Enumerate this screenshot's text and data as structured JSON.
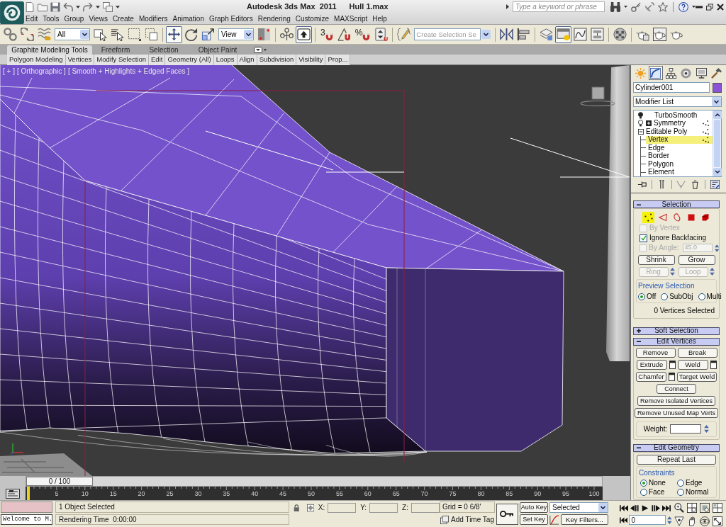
{
  "title_bar": {
    "quick_access": [
      {
        "kind": "new"
      },
      {
        "kind": "open"
      },
      {
        "kind": "save"
      },
      {
        "kind": "undo",
        "dropdown": true
      },
      {
        "kind": "redo",
        "dropdown": true
      },
      {
        "kind": "project",
        "dropdown": true
      }
    ],
    "title": "Autodesk 3ds Max  2011",
    "document": "Hull 1.max",
    "search": {
      "placeholder": "Type a keyword or phrase"
    },
    "tools": [
      {
        "kind": "binoculars",
        "dropdown": true
      },
      {
        "kind": "key"
      },
      {
        "kind": "satellite"
      },
      {
        "kind": "star"
      },
      {
        "kind": "help",
        "dropdown": true
      }
    ],
    "window_controls": [
      {
        "kind": "minimize"
      },
      {
        "kind": "restore"
      },
      {
        "kind": "close"
      }
    ]
  },
  "menu_bar": [
    "Edit",
    "Tools",
    "Group",
    "Views",
    "Create",
    "Modifiers",
    "Animation",
    "Graph Editors",
    "Rendering",
    "Customize",
    "MAXScript",
    "Help"
  ],
  "main_toolbar": [
    {
      "kind": "link",
      "selected": false
    },
    {
      "kind": "unlink",
      "selected": false
    },
    {
      "kind": "bind",
      "selected": false
    },
    {
      "kind": "filter",
      "value": "All"
    },
    {
      "kind": "select",
      "selected": false
    },
    {
      "kind": "select_by_name",
      "selected": false
    },
    {
      "kind": "region",
      "selected": false
    },
    {
      "kind": "crossing",
      "selected": false
    },
    {
      "kind": "separator"
    },
    {
      "kind": "move",
      "selected": true
    },
    {
      "kind": "rotate",
      "selected": false
    },
    {
      "kind": "scale",
      "selected": false
    },
    {
      "kind": "coordsys",
      "value": "View"
    },
    {
      "kind": "pivot",
      "selected": false
    },
    {
      "kind": "separator"
    },
    {
      "kind": "manipulate",
      "selected": false
    },
    {
      "kind": "shortcut",
      "selected": true
    },
    {
      "kind": "separator"
    },
    {
      "kind": "snap",
      "label": "3",
      "selected": false
    },
    {
      "kind": "angle_snap",
      "selected": false
    },
    {
      "kind": "percent_snap",
      "label": "%",
      "selected": false
    },
    {
      "kind": "spinner_snap",
      "selected": false
    },
    {
      "kind": "separator"
    },
    {
      "kind": "named_sets",
      "selected": false
    },
    {
      "kind": "selset",
      "placeholder": "Create Selection Se"
    },
    {
      "kind": "separator"
    },
    {
      "kind": "mirror",
      "selected": false
    },
    {
      "kind": "align",
      "selected": false
    },
    {
      "kind": "separator"
    },
    {
      "kind": "layers",
      "selected": false
    },
    {
      "kind": "graphite",
      "selected": true
    },
    {
      "kind": "curve_editor",
      "selected": false
    },
    {
      "kind": "schematic",
      "selected": false
    },
    {
      "kind": "separator"
    },
    {
      "kind": "material_editor",
      "selected": false
    },
    {
      "kind": "separator"
    },
    {
      "kind": "render_setup",
      "selected": false
    },
    {
      "kind": "frame_window",
      "selected": false
    },
    {
      "kind": "render",
      "selected": false
    }
  ],
  "ribbon": {
    "tabs": [
      {
        "label": "Graphite Modeling Tools",
        "selected": true
      },
      {
        "label": "Freeform",
        "selected": false
      },
      {
        "label": "Selection",
        "selected": false
      },
      {
        "label": "Object Paint",
        "selected": false
      }
    ],
    "panels": [
      "Polygon Modeling",
      "Vertices",
      "Modify Selection",
      "Edit",
      "Geometry (All)",
      "Loops",
      "Align",
      "Subdivision",
      "Visibility",
      "Prop..."
    ]
  },
  "viewport": {
    "labels": [
      "[ + ]",
      "[ Orthographic ]",
      "[ Smooth + Highlights + Edged Faces ]"
    ]
  },
  "command_panel": {
    "tabs": [
      {
        "kind": "create",
        "selected": false
      },
      {
        "kind": "modify",
        "selected": true
      },
      {
        "kind": "hierarchy",
        "selected": false
      },
      {
        "kind": "motion",
        "selected": false
      },
      {
        "kind": "display",
        "selected": false
      },
      {
        "kind": "utilities",
        "selected": false
      }
    ],
    "object": {
      "name": "Cylinder001",
      "color": "#8c52d8"
    },
    "modifier_list": "Modifier List",
    "stack": [
      {
        "label": "TurboSmooth",
        "on": false
      },
      {
        "label": "Symmetry",
        "on": true,
        "expanded": false,
        "marked": true
      },
      {
        "label": "Editable Poly",
        "expanded": true,
        "marked": true,
        "children": [
          {
            "label": "Vertex",
            "selected": true,
            "marked": true
          },
          {
            "label": "Edge",
            "selected": false
          },
          {
            "label": "Border",
            "selected": false
          },
          {
            "label": "Polygon",
            "selected": false
          },
          {
            "label": "Element",
            "selected": false
          }
        ]
      }
    ],
    "stack_tools": [
      {
        "kind": "pin"
      },
      {
        "kind": "show_end"
      },
      {
        "kind": "make_unique"
      },
      {
        "kind": "remove"
      },
      {
        "kind": "configure"
      }
    ],
    "selection": {
      "title": "Selection",
      "expanded": true,
      "levels": [
        {
          "kind": "vertex",
          "selected": true
        },
        {
          "kind": "edge",
          "selected": false
        },
        {
          "kind": "border",
          "selected": false
        },
        {
          "kind": "polygon",
          "selected": false
        },
        {
          "kind": "element",
          "selected": false
        }
      ],
      "options": [
        {
          "label": "By Vertex",
          "checked": false,
          "disabled": true
        },
        {
          "label": "Ignore Backfacing",
          "checked": true,
          "disabled": false
        },
        {
          "label": "By Angle:",
          "checked": false,
          "disabled": true,
          "value": "45.0"
        }
      ],
      "buttons": [
        [
          {
            "label": "Shrink",
            "disabled": false
          },
          {
            "label": "Grow",
            "disabled": false
          }
        ],
        [
          {
            "label": "Ring",
            "disabled": true,
            "spinner": true
          },
          {
            "label": "Loop",
            "disabled": true,
            "spinner": true
          }
        ]
      ],
      "preview": {
        "title": "Preview Selection",
        "options": [
          {
            "label": "Off",
            "selected": true
          },
          {
            "label": "SubObj",
            "selected": false
          },
          {
            "label": "Multi",
            "selected": false
          }
        ]
      },
      "status": "0 Vertices Selected"
    },
    "soft_selection": {
      "title": "Soft Selection",
      "expanded": false
    },
    "edit_vertices": {
      "title": "Edit Vertices",
      "expanded": true,
      "buttons": [
        [
          {
            "label": "Remove"
          },
          {
            "label": "Break"
          }
        ],
        [
          {
            "label": "Extrude",
            "settings": true
          },
          {
            "label": "Weld",
            "settings": true
          }
        ],
        [
          {
            "label": "Chamfer",
            "settings": true
          },
          {
            "label": "Target Weld"
          }
        ],
        [
          {
            "label": "Connect"
          }
        ],
        [
          {
            "label": "Remove Isolated Vertices"
          }
        ],
        [
          {
            "label": "Remove Unused Map Verts"
          }
        ]
      ],
      "weight": {
        "label": "Weight:"
      }
    },
    "edit_geometry": {
      "title": "Edit Geometry",
      "expanded": true,
      "buttons": [
        {
          "label": "Repeat Last"
        }
      ],
      "constraints": {
        "title": "Constraints",
        "options": [
          {
            "label": "None",
            "selected": true
          },
          {
            "label": "Edge",
            "selected": false
          },
          {
            "label": "Face",
            "selected": false
          },
          {
            "label": "Normal",
            "selected": false
          }
        ]
      }
    }
  },
  "time_slider": {
    "label": "0 / 100",
    "level": 0
  },
  "track_bar": {
    "labels": [
      "5",
      "10",
      "15",
      "20",
      "25",
      "30",
      "35",
      "40",
      "45",
      "50",
      "55",
      "60",
      "65",
      "70",
      "75",
      "80",
      "85",
      "90",
      "95",
      "100"
    ]
  },
  "status_bar": {
    "listener_output": "Welcome to M.",
    "prompt": "1 Object Selected",
    "render_time": "Rendering Time  0:00:00",
    "coordinates": [
      {
        "label": "X:"
      },
      {
        "label": "Y:"
      },
      {
        "label": "Z:"
      }
    ],
    "grid": "Grid = 0 6/8'",
    "time_tag": "Add Time Tag",
    "auto_key": {
      "label": "Auto Key",
      "on": false
    },
    "set_key": "Set Key",
    "key_mode": "Selected",
    "key_filters": "Key Filters...",
    "playback": [
      {
        "kind": "start"
      },
      {
        "kind": "prev"
      },
      {
        "kind": "play"
      },
      {
        "kind": "next"
      },
      {
        "kind": "end"
      }
    ],
    "frame": "0",
    "navigation": [
      {
        "kind": "zoom"
      },
      {
        "kind": "zoom_all"
      },
      {
        "kind": "zoom_extents"
      },
      {
        "kind": "zoom_extents_all"
      },
      {
        "kind": "field_of_view"
      },
      {
        "kind": "pan"
      },
      {
        "kind": "orbit"
      },
      {
        "kind": "maximize"
      }
    ]
  }
}
